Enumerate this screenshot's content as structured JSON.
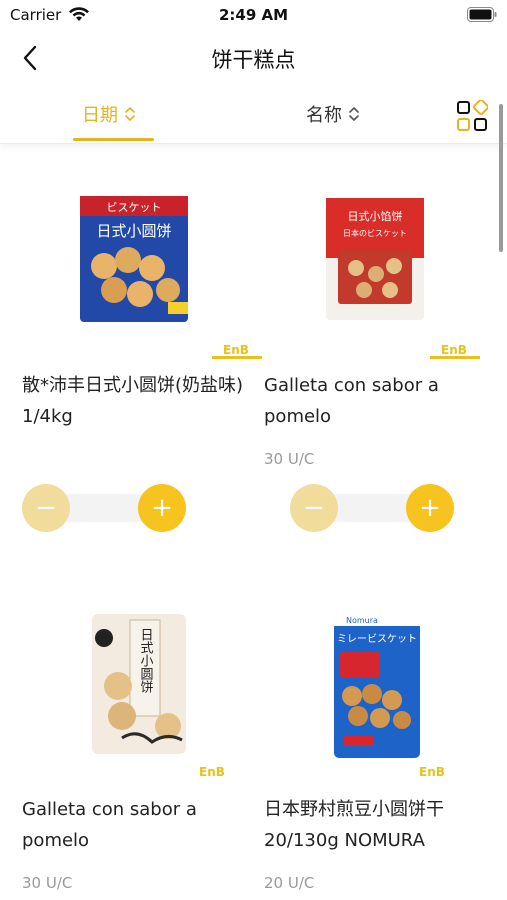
{
  "status_bar": {
    "carrier": "Carrier",
    "time": "2:49 AM"
  },
  "nav": {
    "title": "饼干糕点"
  },
  "sort": {
    "date_label": "日期",
    "name_label": "名称",
    "active": "date"
  },
  "colors": {
    "accent": "#e7b321",
    "plus_button": "#f7c31f",
    "minus_button": "#f2dc9b"
  },
  "products": [
    {
      "name": "散*沛丰日式小圆饼(奶盐味) 1/4kg",
      "unit": "",
      "has_stepper": true,
      "package_text": "日式小圆饼",
      "package_header": "ビスケット"
    },
    {
      "name": "Galleta con sabor a pomelo",
      "unit": "30 U/C",
      "has_stepper": true,
      "package_text": "日式小馅饼",
      "package_header": "日本のビスケット"
    },
    {
      "name": "Galleta con sabor a pomelo",
      "unit": "30 U/C",
      "has_stepper": false,
      "package_text": "日式小圆饼",
      "package_header": ""
    },
    {
      "name": "日本野村煎豆小圆饼干20/130g NOMURA",
      "unit": "20 U/C",
      "has_stepper": false,
      "package_text": "ミレービスケット",
      "package_header": "Nomura"
    }
  ],
  "brand_logo_text": "EnB",
  "stepper": {
    "minus_symbol": "−",
    "plus_symbol": "+"
  }
}
